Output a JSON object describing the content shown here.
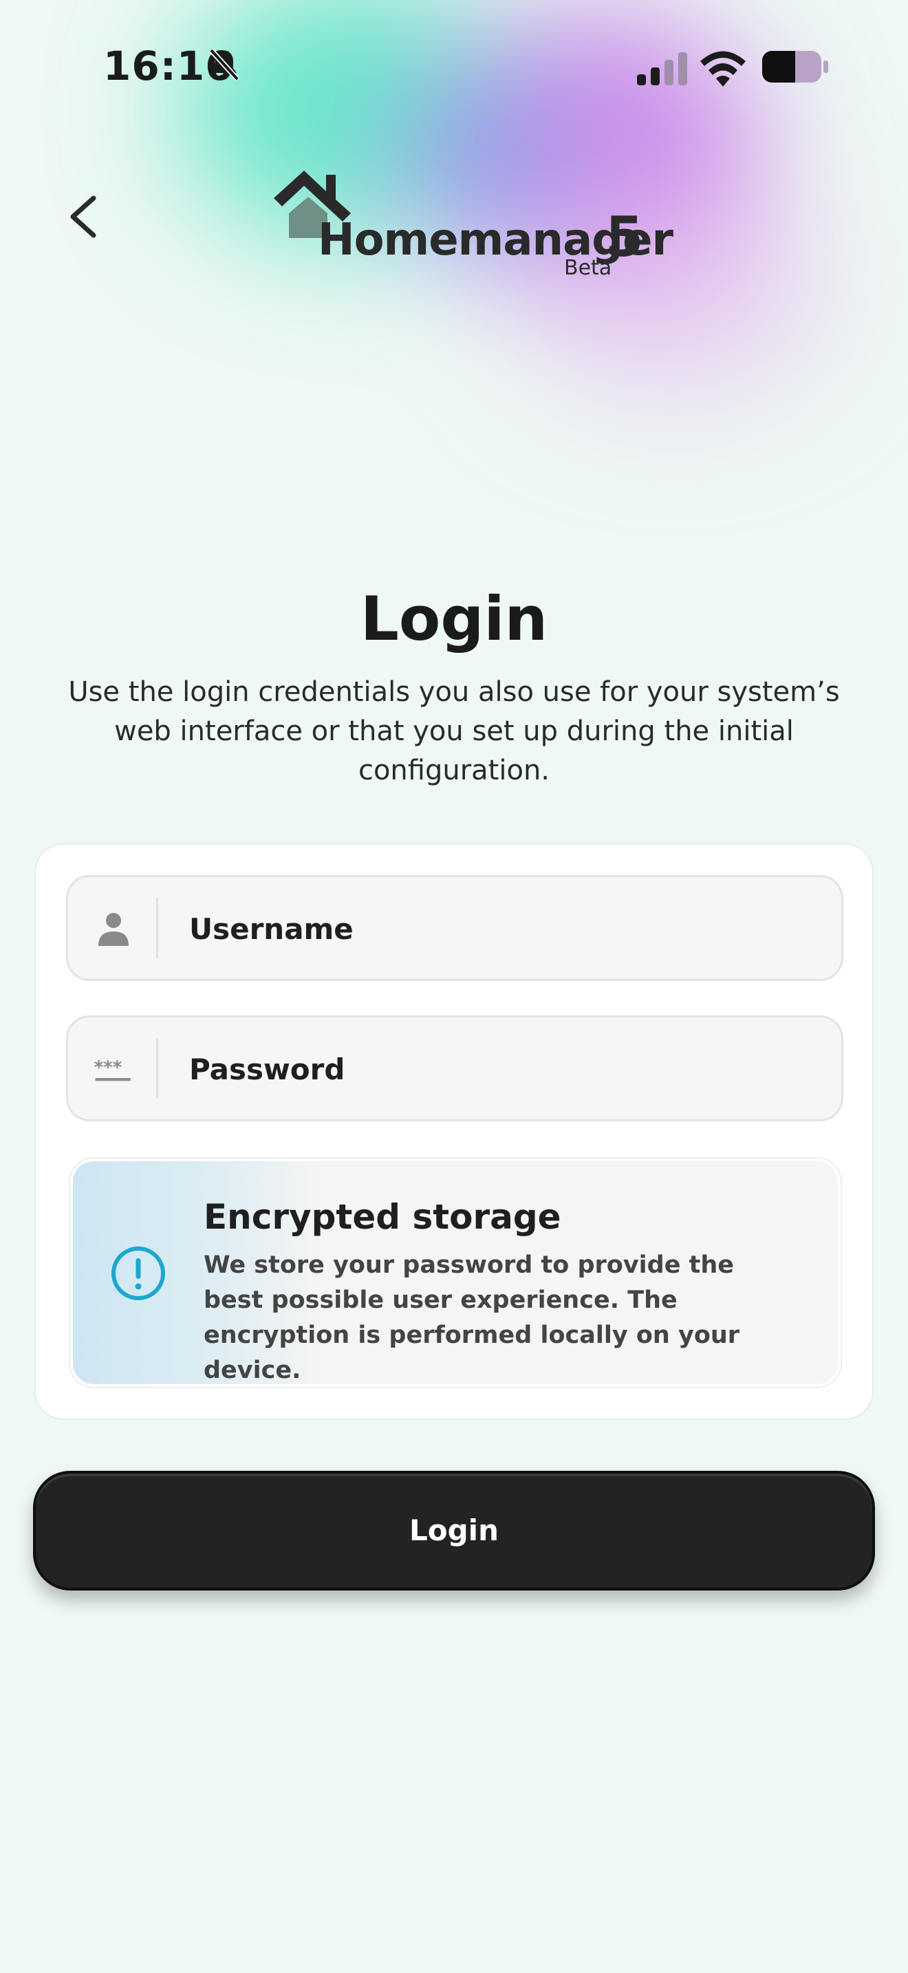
{
  "status_bar": {
    "time": "16:16",
    "icons": [
      "bell-muted-icon",
      "cellular-signal-icon",
      "wifi-icon",
      "battery-icon"
    ]
  },
  "nav": {
    "back_icon": "chevron-left-icon"
  },
  "brand": {
    "name": "Homemanager",
    "version": "5",
    "tag": "Beta",
    "logo_icon": "house-icon"
  },
  "login": {
    "title": "Login",
    "description": "Use the login credentials you also use for your system’s web interface or that you set up during the initial configuration.",
    "username_placeholder": "Username",
    "username_icon": "user-icon",
    "password_placeholder": "Password",
    "password_icon": "password-icon",
    "notice": {
      "icon": "info-exclamation-icon",
      "title": "Encrypted storage",
      "text": "We store your password to provide the best possible user experience. The encryption is performed locally on your device."
    },
    "submit_label": "Login"
  },
  "colors": {
    "background": "#eef8f4",
    "button": "#232323",
    "accent_info": "#1ba7cf",
    "blob_teal": "#4fe3c2",
    "blob_purple": "#c77ae8"
  }
}
